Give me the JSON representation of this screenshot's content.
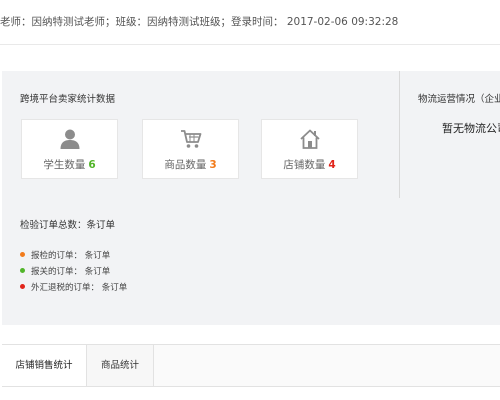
{
  "header": {
    "info_text": "老师：因纳特测试老师；班级：因纳特测试班级；登录时间：  2017-02-06 09:32:28"
  },
  "stats_section": {
    "title": "跨境平台卖家统计数据",
    "cards": [
      {
        "label": "学生数量",
        "count": "6",
        "icon": "user-icon",
        "count_color": "#52b52a"
      },
      {
        "label": "商品数量",
        "count": "3",
        "icon": "cart-icon",
        "count_color": "#f27b1b"
      },
      {
        "label": "店铺数量",
        "count": "4",
        "icon": "home-icon",
        "count_color": "#e1251b"
      }
    ]
  },
  "logistics": {
    "title": "物流运营情况（企业源",
    "empty_text": "暂无物流公司"
  },
  "orders": {
    "total_label": "检验订单总数：条订单",
    "items": [
      {
        "label": "报检的订单：  条订单",
        "color": "#f27b1b"
      },
      {
        "label": "报关的订单：  条订单",
        "color": "#52b52a"
      },
      {
        "label": "外汇退税的订单：  条订单",
        "color": "#e1251b"
      }
    ]
  },
  "tabs": [
    {
      "label": "店铺销售统计",
      "active": true
    },
    {
      "label": "商品统计",
      "active": false
    }
  ]
}
